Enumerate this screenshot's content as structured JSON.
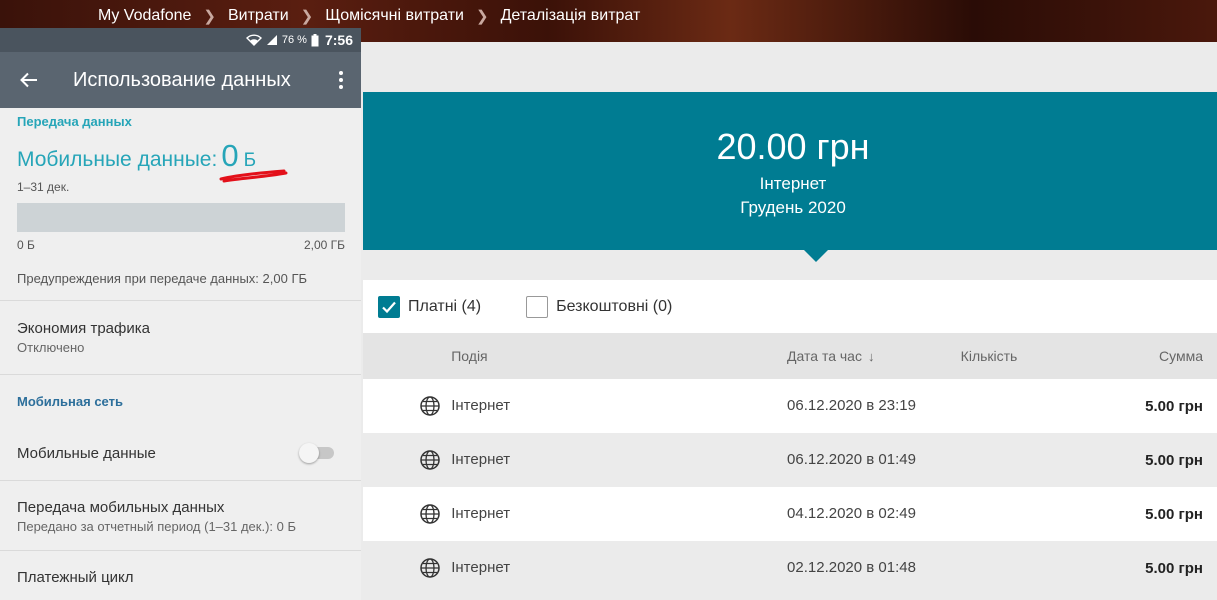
{
  "breadcrumb": [
    "My Vodafone",
    "Витрати",
    "Щомісячні витрати",
    "Деталізація витрат"
  ],
  "banner": {
    "amount": "20.00 грн",
    "service": "Інтернет",
    "period": "Грудень 2020",
    "color": "#007c92"
  },
  "filters": {
    "paid": {
      "label": "Платні (4)",
      "checked": true
    },
    "free": {
      "label": "Безкоштовні (0)",
      "checked": false
    }
  },
  "table": {
    "columns": {
      "event": "Подія",
      "datetime": "Дата та час",
      "quantity": "Кількість",
      "sum": "Сумма"
    },
    "rows": [
      {
        "icon": "globe-icon",
        "event": "Інтернет",
        "datetime": "06.12.2020 в 23:19",
        "quantity": "",
        "sum": "5.00 грн"
      },
      {
        "icon": "globe-icon",
        "event": "Інтернет",
        "datetime": "06.12.2020 в 01:49",
        "quantity": "",
        "sum": "5.00 грн"
      },
      {
        "icon": "globe-icon",
        "event": "Інтернет",
        "datetime": "04.12.2020 в 02:49",
        "quantity": "",
        "sum": "5.00 грн"
      },
      {
        "icon": "globe-icon",
        "event": "Інтернет",
        "datetime": "02.12.2020 в 01:48",
        "quantity": "",
        "sum": "5.00 грн"
      }
    ]
  },
  "phone": {
    "status": {
      "battery": "76 %",
      "time": "7:56"
    },
    "title": "Использование данных",
    "data_section": "Передача данных",
    "mobile_data_label": "Мобильные данные:",
    "mobile_data_value": "0",
    "mobile_data_unit": "Б",
    "period": "1–31 дек.",
    "usage_fraction": 0,
    "bar_min": "0 Б",
    "bar_max": "2,00 ГБ",
    "warning": "Предупреждения при передаче данных: 2,00 ГБ",
    "saver": {
      "title": "Экономия трафика",
      "sub": "Отключено"
    },
    "network_section": "Мобильная сеть",
    "mobile_data_toggle": {
      "label": "Мобильные данные",
      "on": false
    },
    "transfer": {
      "title": "Передача мобильных данных",
      "sub": "Передано за отчетный период (1–31 дек.): 0 Б"
    },
    "billing": "Платежный цикл",
    "accent_color": "#26a5b8"
  }
}
